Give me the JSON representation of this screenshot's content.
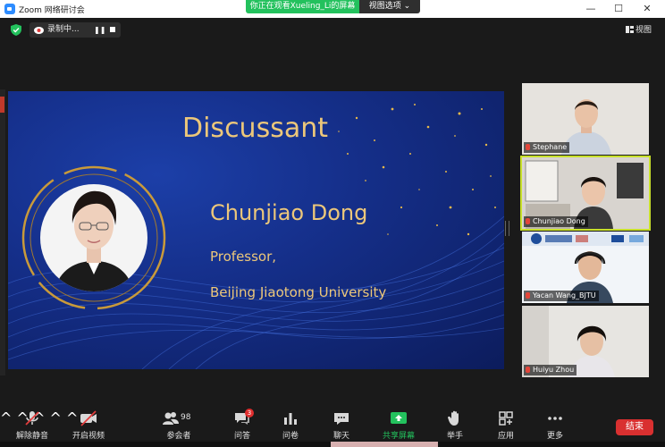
{
  "window": {
    "title": "Zoom 网络研讨会",
    "min": "—",
    "max": "☐",
    "close": "✕"
  },
  "share_banner": {
    "text": "你正在观看Xueling_Li的屏幕",
    "view_options": "视图选项 ⌄"
  },
  "status": {
    "recording": "录制中...",
    "view": "视图"
  },
  "slide": {
    "heading": "Discussant",
    "name": "Chunjiao Dong",
    "role": "Professor,",
    "org": "Beijing Jiaotong University",
    "accent": "#ecc77a"
  },
  "participants": [
    {
      "name": "Stephane"
    },
    {
      "name": "Chunjiao Dong"
    },
    {
      "name": "Yacan Wang_BJTU"
    },
    {
      "name": "Huiyu Zhou"
    }
  ],
  "toolbar": {
    "unmute": "解除静音",
    "start_video": "开启视频",
    "participants": "参会者",
    "participants_count": "98",
    "qa": "问答",
    "qa_badge": "3",
    "polls": "问卷",
    "chat": "聊天",
    "share": "共享屏幕",
    "raise_hand": "举手",
    "apps": "应用",
    "more": "更多",
    "end": "结束"
  },
  "colors": {
    "share_green": "#23c15d",
    "end_red": "#d93030",
    "active_speaker": "#c8e02a"
  }
}
